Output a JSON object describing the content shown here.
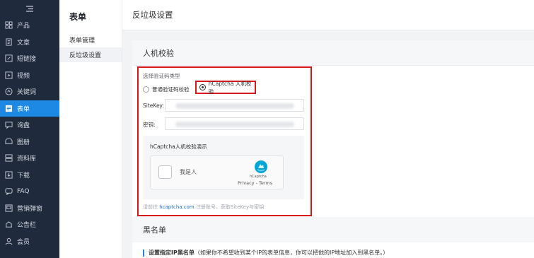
{
  "sidebar": {
    "items": [
      {
        "label": "产品",
        "icon": "grid-icon"
      },
      {
        "label": "文章",
        "icon": "document-icon"
      },
      {
        "label": "短链接",
        "icon": "link-icon"
      },
      {
        "label": "视频",
        "icon": "video-icon"
      },
      {
        "label": "关键词",
        "icon": "keyword-icon"
      },
      {
        "label": "表单",
        "icon": "form-icon",
        "active": true
      },
      {
        "label": "询盘",
        "icon": "inquiry-icon"
      },
      {
        "label": "图册",
        "icon": "album-icon"
      },
      {
        "label": "资料库",
        "icon": "library-icon"
      },
      {
        "label": "下载",
        "icon": "download-icon"
      },
      {
        "label": "FAQ",
        "icon": "faq-icon"
      },
      {
        "label": "营销弹窗",
        "icon": "popup-icon"
      },
      {
        "label": "公告栏",
        "icon": "announcement-icon"
      },
      {
        "label": "会员",
        "icon": "member-icon"
      }
    ]
  },
  "submenu": {
    "title": "表单",
    "items": [
      "表单管理",
      "反垃圾设置"
    ]
  },
  "header": {
    "title": "反垃圾设置"
  },
  "captcha": {
    "section_title": "人机校验",
    "type_label": "选择验证码类型",
    "option_normal": "普通验证码校验",
    "option_hcaptcha": "hCaptcha 人机校验",
    "sitekey_label": "SiteKey:",
    "secret_label": "密钥:",
    "demo_title": "hCaptcha人机校验演示",
    "widget_text": "我是人",
    "widget_brand": "hCaptcha",
    "widget_links": "Privacy - Terms",
    "note_prefix": "请前往",
    "note_link": "hcaptcha.com",
    "note_suffix": "注册账号、获取SiteKey与密钥"
  },
  "blacklist": {
    "section_title": "黑名单",
    "tip_bold": "设置指定IP黑名单",
    "tip_text": "（如果你不希望收到某个IP的表单信息，你可以把他的IP地址加入到黑名单。）"
  },
  "colors": {
    "sidebar_bg": "#1f2a3d",
    "accent": "#1e88e5",
    "highlight": "#d7191e"
  }
}
